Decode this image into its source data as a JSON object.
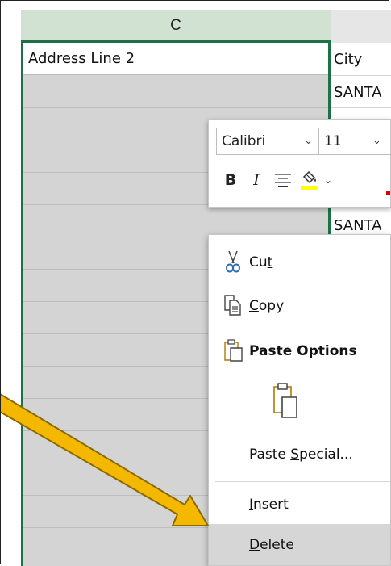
{
  "sheet": {
    "column_c_header": "C",
    "cell_c1": "Address Line 2",
    "column_d_cells": [
      "City",
      "SANTA",
      "SANTA"
    ]
  },
  "mini_toolbar": {
    "font_name": "Calibri",
    "font_size": "11",
    "bold_label": "B",
    "italic_label": "I"
  },
  "context_menu": {
    "cut": {
      "prefix": "Cu",
      "accel": "t",
      "suffix": ""
    },
    "copy": {
      "prefix": "",
      "accel": "C",
      "suffix": "opy"
    },
    "paste_options": "Paste Options",
    "paste_special": {
      "prefix": "Paste ",
      "accel": "S",
      "suffix": "pecial..."
    },
    "insert": {
      "prefix": "",
      "accel": "I",
      "suffix": "nsert"
    },
    "delete": {
      "prefix": "",
      "accel": "D",
      "suffix": "elete"
    }
  },
  "colors": {
    "selection_green": "#1e7145",
    "selected_column_fill": "#d4d4d4",
    "arrow_fill": "#f5b800",
    "arrow_outline": "#8a6a00",
    "menu_highlight": "#d6d6d6"
  },
  "icons": [
    "scissors-icon",
    "copy-icon",
    "paste-icon",
    "paste-option-icon",
    "center-align-icon",
    "fill-color-icon"
  ]
}
